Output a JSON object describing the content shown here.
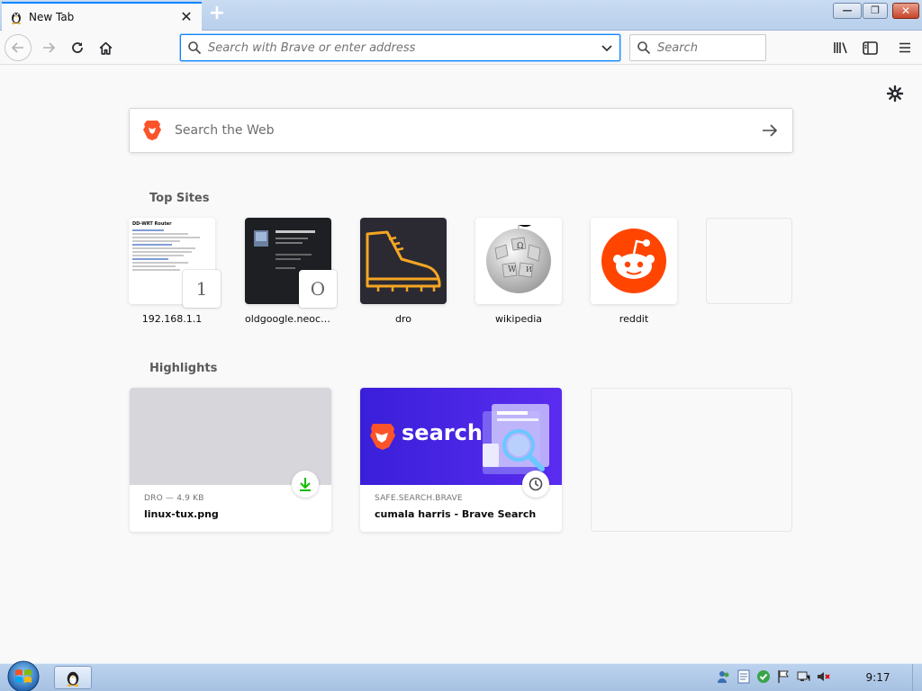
{
  "browser": {
    "tab": {
      "title": "New Tab",
      "close_glyph": "✕",
      "favicon": "tux-icon"
    },
    "new_tab_glyph": "+",
    "window_controls": {
      "minimize": "—",
      "maximize": "❐",
      "close": "✕"
    },
    "urlbar": {
      "placeholder": "Search with Brave or enter address",
      "value": ""
    },
    "searchbar": {
      "placeholder": "Search"
    },
    "icons": [
      "back-icon",
      "forward-icon",
      "reload-icon",
      "home-icon",
      "library-icon",
      "sidebar-icon",
      "menu-icon"
    ]
  },
  "newtab": {
    "web_search_placeholder": "Search the Web",
    "top_sites_title": "Top Sites",
    "top_sites": [
      {
        "label": "192.168.1.1",
        "letter": "1",
        "thumb": "Tomato-style router page"
      },
      {
        "label": "oldgoogle.neoci...",
        "letter": "O"
      },
      {
        "label": "dro"
      },
      {
        "label": "wikipedia"
      },
      {
        "label": "reddit"
      },
      {
        "label": ""
      }
    ],
    "router_page_heading": "DD-WRT Router",
    "highlights_title": "Highlights",
    "highlights": [
      {
        "source": "DRO — 4.9 KB",
        "title": "linux-tux.png",
        "badge": "download-icon"
      },
      {
        "source": "SAFE.SEARCH.BRAVE",
        "title": "cumala harris - Brave Search",
        "badge": "clock-icon",
        "image_text": "search"
      }
    ]
  },
  "taskbar": {
    "clock": "9:17"
  },
  "colors": {
    "accent": "#0a84ff",
    "brave_orange": "#fb542b",
    "reddit": "#ff4500",
    "search_banner": "#3d23e0"
  }
}
